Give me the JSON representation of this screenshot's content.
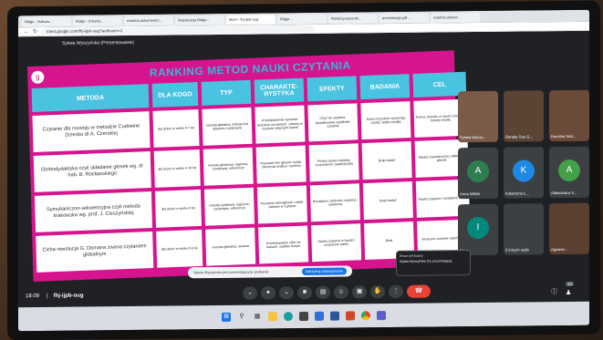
{
  "browser": {
    "tabs": [
      "Ridge - Sukces...",
      "Ridge - Instytut...",
      "ewelina.dokumentrz...",
      "Rejestracja Ridge...",
      "Meet - fhj-ijpb-oug",
      "Ridge...",
      "Ranking wyszuki...",
      "prezentacja.pdf...",
      "ewelina.dokum..."
    ],
    "active_tab": 4,
    "url": "meet.google.com/fhj-ijpb-oug?authuser=1"
  },
  "meet": {
    "presenter": "Sylwia Wyszyńska (Prezentowanie)",
    "time": "18:09",
    "code": "fhj-ijpb-oug",
    "toast_text": "Sylwia Wyszyńska jest prezentującą tę spotkanie",
    "toast_button": "Zatrzymaj udostępnianie",
    "chip_title": "Ekran pół ściany",
    "chip_item": "Sylwia Wyszyńska (Ty, prezentującą)",
    "participant_count": "14"
  },
  "slide": {
    "title": "RANKING METOD NAUKI CZYTANIA",
    "logo": "genially",
    "headers": [
      "METODA",
      "DLA KOGO",
      "TYP",
      "CHARAKTE-RYSTYKA",
      "EFEKTY",
      "BADANIA",
      "CEL"
    ],
    "rows": [
      [
        "Czytanie dla rozwoju w metodzie Cudowne Dziecko dr A. Czerskiej",
        "dla dzieci w wieku 0-7 lat",
        "metoda globalna, holistyczna aktywna, tradycyjna",
        "Przedstawienie wyrazów dzieciom na kartach, zabawy w czytanie własnych kartek",
        "Chęć do czytania, kształtowanie szybkości czytania",
        "Dzieci wcześnie zaczynają czytać, lepiej czytają",
        "Pomoc dziecku w nauce czytania, rozwój umysłu"
      ],
      [
        "Glottodydaktyka czyli składanie głosek wg. dr hab. B. Rocławskiego",
        "dla dzieci w wieku 4-10 lat",
        "metoda głoskowa, logiczna, zamknięta, odtwórcza",
        "Poznanie liter głosek i sylab, ćwiczenia analizy i syntezy",
        "Prosta nauka czytania, zrozumienie zasad języka",
        "Brak badań",
        "Nauka czytania przez składanie głosek"
      ],
      [
        "Symultaniczno-sekwencyjna czyli metoda krakowska wg. prof. J. Cieszyńskiej",
        "dla dzieci w wieku 0 lat",
        "metoda sylabowa, logiczna, zamknięta, odtwórcza",
        "Poznanie samogłosek i sylab, zabawy w czytanie",
        "Rozwijanie zdolności czytania i mówienia",
        "Brak badań",
        "Nauka czytania i rozwijanie mowy"
      ],
      [
        "Cicha rewolucja G. Domana zwana czytaniem globalnym",
        "dla dzieci w wieku 0-6 lat",
        "metoda globalna, otwarta",
        "Przedstawianie słów na kartach, szybkie tempo",
        "Nauka czytania w bardzo wczesnym wieku",
        "Brak",
        "Wczesne czytanie całych słów"
      ]
    ]
  },
  "participants": [
    {
      "name": "Sylwia Wyszy...",
      "initial": "",
      "color": "#7a5a48"
    },
    {
      "name": "Renata Sas-G...",
      "initial": "",
      "color": "#5a4434"
    },
    {
      "name": "Karolina Wal...",
      "initial": "",
      "color": "#6a4a38"
    },
    {
      "name": "Anna Wilski",
      "initial": "A",
      "color": "#2e7d4f"
    },
    {
      "name": "Katarzyna Ł...",
      "initial": "K",
      "color": "#1e88e5"
    },
    {
      "name": "Aleksandra S...",
      "initial": "A",
      "color": "#43a047"
    },
    {
      "name": "Ilona",
      "initial": "I",
      "color": "#00897b"
    },
    {
      "name": "5 innych osób",
      "initial": "",
      "color": "#3c4043"
    },
    {
      "name": "Agniesz...",
      "initial": "",
      "color": "#5a4030"
    }
  ]
}
